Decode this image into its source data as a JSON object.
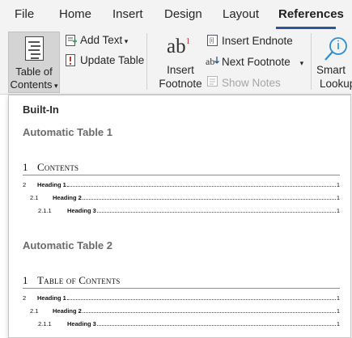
{
  "ribbon_tabs": {
    "file": "File",
    "home": "Home",
    "insert": "Insert",
    "design": "Design",
    "layout": "Layout",
    "references": "References"
  },
  "toc_group": {
    "toc_line1": "Table of",
    "toc_line2": "Contents",
    "add_text": "Add Text",
    "update_table": "Update Table"
  },
  "footnotes_group": {
    "insert_footnote_line1": "Insert",
    "insert_footnote_line2": "Footnote",
    "insert_footnote_glyph": "ab",
    "superscript": "1",
    "insert_endnote": "Insert Endnote",
    "next_footnote": "Next Footnote",
    "show_notes": "Show Notes"
  },
  "research_group": {
    "smart_lookup_line1": "Smart",
    "smart_lookup_line2": "Lookup"
  },
  "dropdown": {
    "section_title": "Built-In",
    "tables": [
      {
        "title": "Automatic Table 1",
        "heading_num": "1",
        "heading_text": "Contents",
        "entries": [
          {
            "num": "2",
            "text": "Heading 1",
            "page": "1"
          },
          {
            "num": "2.1",
            "text": "Heading 2",
            "page": "1"
          },
          {
            "num": "2.1.1",
            "text": "Heading 3",
            "page": "1"
          }
        ]
      },
      {
        "title": "Automatic Table 2",
        "heading_num": "1",
        "heading_text": "Table of Contents",
        "entries": [
          {
            "num": "2",
            "text": "Heading 1",
            "page": "1"
          },
          {
            "num": "2.1",
            "text": "Heading 2",
            "page": "1"
          },
          {
            "num": "2.1.1",
            "text": "Heading 3",
            "page": "1"
          }
        ]
      }
    ]
  },
  "colors": {
    "accent": "#2b579a",
    "ribbon_bg": "#f3f3f3",
    "footnote_superscript": "#c0392b"
  }
}
